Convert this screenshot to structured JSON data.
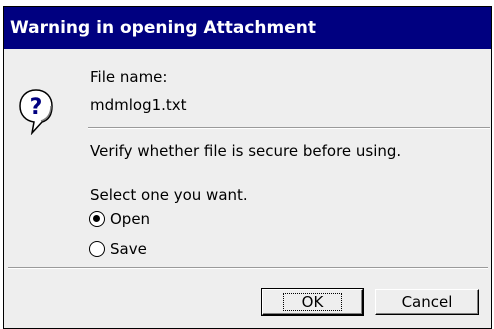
{
  "dialog": {
    "title": "Warning in opening Attachment",
    "file_name_label": "File name:",
    "file_name_value": "mdmlog1.txt",
    "message": "Verify whether file is secure before using.",
    "select_prompt": "Select one you want.",
    "options": [
      {
        "label": "Open",
        "selected": true
      },
      {
        "label": "Save",
        "selected": false
      }
    ],
    "buttons": {
      "ok_label": "OK",
      "cancel_label": "Cancel"
    },
    "icon": "question-bubble-icon",
    "colors": {
      "titlebar": "#000080",
      "icon_blue": "#000080",
      "body": "#eeeeee"
    }
  }
}
